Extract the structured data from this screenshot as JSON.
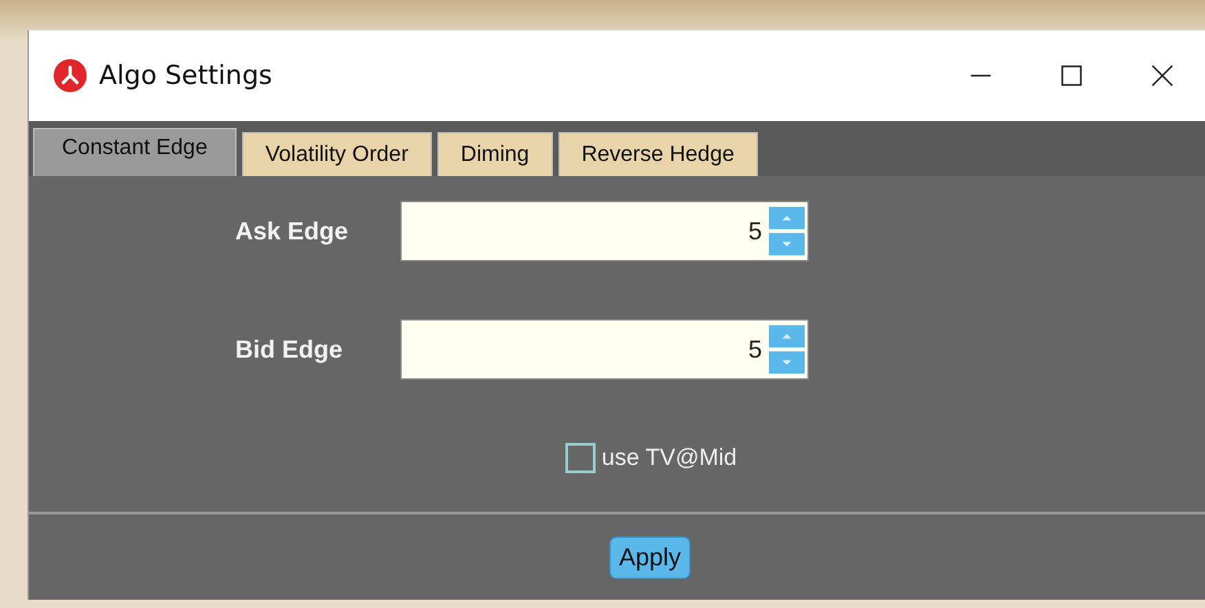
{
  "window": {
    "title": "Algo Settings"
  },
  "tabs": [
    {
      "label": "Constant Edge",
      "selected": true
    },
    {
      "label": "Volatility Order",
      "selected": false
    },
    {
      "label": "Diming",
      "selected": false
    },
    {
      "label": "Reverse Hedge",
      "selected": false
    }
  ],
  "fields": [
    {
      "label": "Ask Edge",
      "value": "5"
    },
    {
      "label": "Bid Edge",
      "value": "5"
    }
  ],
  "checkbox": {
    "label": "use TV@Mid",
    "checked": false
  },
  "buttons": [
    "Apply"
  ]
}
